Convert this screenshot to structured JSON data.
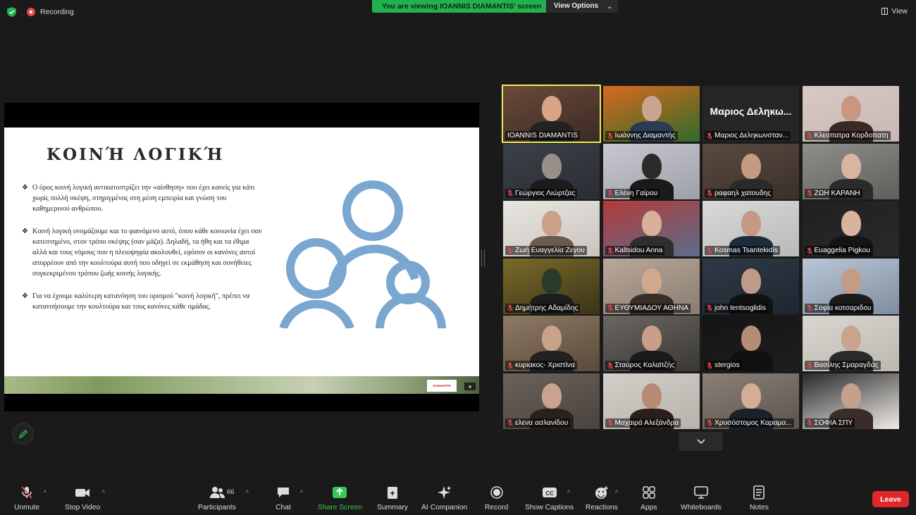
{
  "topbar": {
    "recording_label": "Recording",
    "viewing_prefix": "You are viewing ",
    "viewing_name": "IOANNIS DIAMANTIS' screen",
    "view_options": "View Options",
    "view_button": "View"
  },
  "slide": {
    "title": "ΚΟΙΝΉ ΛΟΓΙΚΉ",
    "bullets": [
      "Ο όρος κοινή λογική αντικατοπτρίζει την «αίσθηση» που έχει κανείς για κάτι χωρίς πολλή σκέψη, στηριγμένος στη μέση εμπειρία και γνώση του καθημερινού ανθρώπου.",
      "Κοινή λογική ονομάζουμε και το φαινόμενο αυτό, όπου κάθε κοινωνία έχει σαν κατεστημένο, στον τρόπο σκέψης (σαν μάζα). Δηλαδή, τα ήθη και τα έθιμα αλλά και τους νόμους που η πλειοψηφία ακολουθεί, εφόσον οι κανόνες αυτοί απορρέουν από την κουλτούρα αυτή που οδηγεί σε εκμάθηση και συνήθειες συγκεκριμένου τρόπου ζωής κοινής λογικής.",
      "Για να έχουμε καλύτερη κατανόηση του ορισμού \"κοινή λογική\", πρέπει να κατανοήσουμε την κουλτούρα και τους κανόνες κάθε ομάδας."
    ],
    "bullet_glyph": "❖",
    "footer_logo": "DIAMANTIS",
    "icon_color": "#7aa7d0"
  },
  "participants": [
    {
      "name": "IOANNIS DIAMANTIS",
      "muted": false,
      "active": true
    },
    {
      "name": "Ιωάννης Διαμαντής",
      "muted": true
    },
    {
      "name": "Μαριος Δεληκωνσταν...",
      "muted": true,
      "big": "Μαριος Δεληκω..."
    },
    {
      "name": "Κλεοπατρα Κορδοπατη",
      "muted": true
    },
    {
      "name": "Γεώργιος Λιώρτζας",
      "muted": true
    },
    {
      "name": "Ελένη Γαίρου",
      "muted": true
    },
    {
      "name": "ραφαηλ χατουδης",
      "muted": true
    },
    {
      "name": "ΖΩΗ ΚΑΡΑΝΗ",
      "muted": true
    },
    {
      "name": "Ζωή Ευαγγελία Ζεγου",
      "muted": true
    },
    {
      "name": "Kaltsidou Anna",
      "muted": true
    },
    {
      "name": "Kosmas Tsantekidis",
      "muted": true
    },
    {
      "name": "Euaggelia Pigkou",
      "muted": true
    },
    {
      "name": "Δημήτρης Αδαμίδης",
      "muted": true
    },
    {
      "name": "ΕΥΘΥΜΙΑΔΟΥ ΑΘΗΝΑ",
      "muted": true
    },
    {
      "name": "john tentsoglidis",
      "muted": true
    },
    {
      "name": "Σοφία κοτσαριδου",
      "muted": true
    },
    {
      "name": "κυριακος- Χριστίνα",
      "muted": true
    },
    {
      "name": "Σταύρος Καλαϊτζής",
      "muted": true
    },
    {
      "name": "stergios",
      "muted": true
    },
    {
      "name": "Βασίλης Σμαραγδάς",
      "muted": true
    },
    {
      "name": "ελενα ασλανίδου",
      "muted": true
    },
    {
      "name": "Μαχαιρά Αλεξάνδρα",
      "muted": true
    },
    {
      "name": "Χρυσόστομος Καραμα...",
      "muted": true
    },
    {
      "name": "ΣΟΦΙΑ ΣΠΥ",
      "muted": true
    }
  ],
  "toolbar": {
    "unmute": "Unmute",
    "stop_video": "Stop Video",
    "participants": "Participants",
    "participants_count": "66",
    "chat": "Chat",
    "share_screen": "Share Screen",
    "summary": "Summary",
    "ai_companion": "AI Companion",
    "record": "Record",
    "show_captions": "Show Captions",
    "reactions": "Reactions",
    "apps": "Apps",
    "whiteboards": "Whiteboards",
    "notes": "Notes",
    "leave": "Leave",
    "accent": "#35c759",
    "leave_color": "#e0262b"
  }
}
